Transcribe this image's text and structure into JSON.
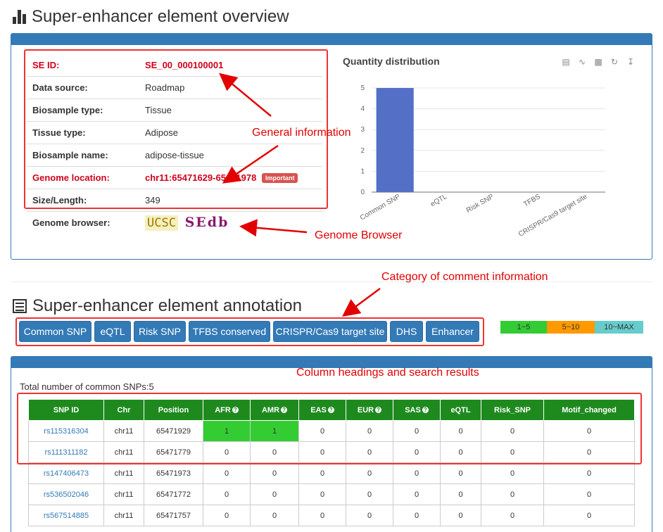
{
  "overview": {
    "title": "Super-enhancer element overview",
    "rows": [
      {
        "label": "SE ID:",
        "value": "SE_00_000100001"
      },
      {
        "label": "Data source:",
        "value": "Roadmap"
      },
      {
        "label": "Biosample type:",
        "value": "Tissue"
      },
      {
        "label": "Tissue type:",
        "value": "Adipose"
      },
      {
        "label": "Biosample name:",
        "value": "adipose-tissue"
      },
      {
        "label": "Genome location:",
        "value": "chr11:65471629-65471978",
        "badge": "Important"
      },
      {
        "label": "Size/Length:",
        "value": "349"
      },
      {
        "label": "Genome browser:",
        "ucsc": "UCSC",
        "sedb": "SEdb"
      }
    ]
  },
  "annotations": {
    "general": "General information",
    "genome_browser": "Genome Browser",
    "category": "Category of comment information",
    "columns": "Column headings and search results"
  },
  "chart_data": {
    "type": "bar",
    "title": "Quantity distribution",
    "categories": [
      "Common SNP",
      "eQTL",
      "Risk SNP",
      "TFBS",
      "CRISPR/Cas9 target site"
    ],
    "values": [
      5,
      0,
      0,
      0,
      0
    ],
    "ylim": [
      0,
      5
    ],
    "yticks": [
      "0",
      "1",
      "2",
      "3",
      "4",
      "5"
    ],
    "grid": true,
    "bar_color": "#5470c6"
  },
  "toolbox": [
    "data-view-icon",
    "line-chart-icon",
    "bar-chart-icon",
    "restore-icon",
    "download-icon"
  ],
  "annotation_section": {
    "title": "Super-enhancer element annotation",
    "tabs": [
      "Common SNP",
      "eQTL",
      "Risk SNP",
      "TFBS conserved",
      "CRISPR/Cas9 target site",
      "DHS",
      "Enhancer"
    ],
    "legend": [
      {
        "label": "1~5",
        "color": "#33cc33"
      },
      {
        "label": "5~10",
        "color": "#ff9900"
      },
      {
        "label": "10~MAX",
        "color": "#66cccc"
      }
    ]
  },
  "snp_table": {
    "total": "Total number of common SNPs:5",
    "headers": [
      "SNP ID",
      "Chr",
      "Position",
      "AFR",
      "AMR",
      "EAS",
      "EUR",
      "SAS",
      "eQTL",
      "Risk_SNP",
      "Motif_changed"
    ],
    "rows": [
      [
        "rs115316304",
        "chr11",
        "65471929",
        "1",
        "1",
        "0",
        "0",
        "0",
        "0",
        "0",
        "0"
      ],
      [
        "rs111311182",
        "chr11",
        "65471779",
        "0",
        "0",
        "0",
        "0",
        "0",
        "0",
        "0",
        "0"
      ],
      [
        "rs147406473",
        "chr11",
        "65471973",
        "0",
        "0",
        "0",
        "0",
        "0",
        "0",
        "0",
        "0"
      ],
      [
        "rs536502046",
        "chr11",
        "65471772",
        "0",
        "0",
        "0",
        "0",
        "0",
        "0",
        "0",
        "0"
      ],
      [
        "rs567514885",
        "chr11",
        "65471757",
        "0",
        "0",
        "0",
        "0",
        "0",
        "0",
        "0",
        "0"
      ]
    ]
  },
  "colors": {
    "primary": "#337ab7",
    "header_green": "#1e8a1e",
    "highlight": "#e30000"
  }
}
